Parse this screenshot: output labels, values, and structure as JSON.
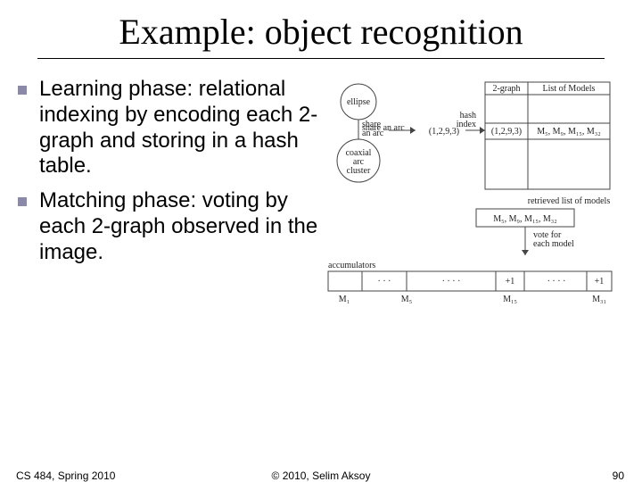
{
  "title": "Example: object recognition",
  "bullets": [
    "Learning phase: relational indexing by encoding each 2-graph and storing in a hash table.",
    "Matching phase: voting by each 2-graph observed in the image."
  ],
  "footer": {
    "left": "CS 484, Spring 2010",
    "center": "© 2010, Selim Aksoy",
    "right": "90"
  },
  "diagram": {
    "node_top": "ellipse",
    "node_mid": "share an arc",
    "node_bottom": "coaxial arc cluster",
    "tuple_enc": "(1,2,9,3)",
    "header_left": "2-graph",
    "header_right": "List of Models",
    "hash_label": "hash index",
    "row_key": "(1,2,9,3)",
    "row_models": "M₅, M₉, M₁₅, M₃₂",
    "retrieved_label": "retrieved list of models",
    "retrieved_value": "M₅, M₉, M₁₅, M₃₂",
    "vote_label_1": "vote for",
    "vote_label_2": "each model",
    "accum_label": "accumulators",
    "accum": {
      "bins": [
        "M₁",
        "M₅",
        "M₁₅",
        "M₃₁"
      ],
      "highlights": [
        "+1",
        "+1"
      ]
    }
  }
}
